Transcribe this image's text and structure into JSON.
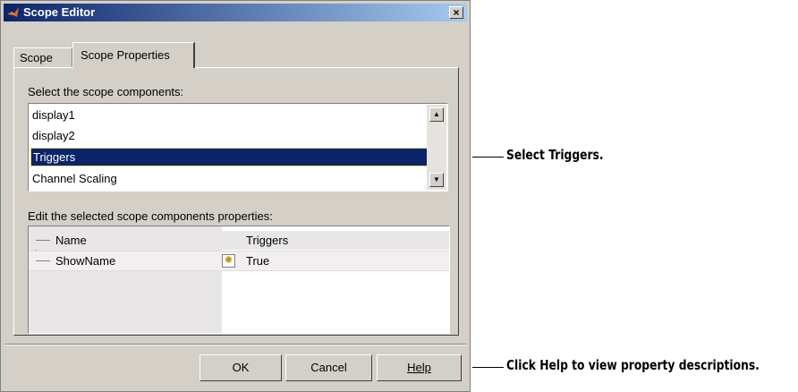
{
  "window": {
    "title": "Scope Editor",
    "close_glyph": "×",
    "icon": "matlab-logo-icon"
  },
  "tabs": [
    {
      "label": "Scope"
    },
    {
      "label": "Scope Properties"
    }
  ],
  "components": {
    "label": "Select the scope components:",
    "items": [
      "display1",
      "display2",
      "Triggers",
      "Channel Scaling"
    ],
    "selected": "Triggers"
  },
  "properties": {
    "label": "Edit the selected scope components properties:",
    "rows": [
      {
        "name": "Name",
        "value": "Triggers"
      },
      {
        "name": "ShowName",
        "value": "True",
        "icon": "lightbulb-icon"
      }
    ]
  },
  "buttons": {
    "ok": "OK",
    "cancel": "Cancel",
    "help": "Help"
  },
  "callouts": {
    "triggers": "Select Triggers.",
    "help": "Click Help to view property descriptions."
  },
  "colors": {
    "selection": "#0a246a",
    "dialog_bg": "#d4d0c8",
    "title_start": "#0a246a",
    "title_end": "#a6caf0"
  }
}
